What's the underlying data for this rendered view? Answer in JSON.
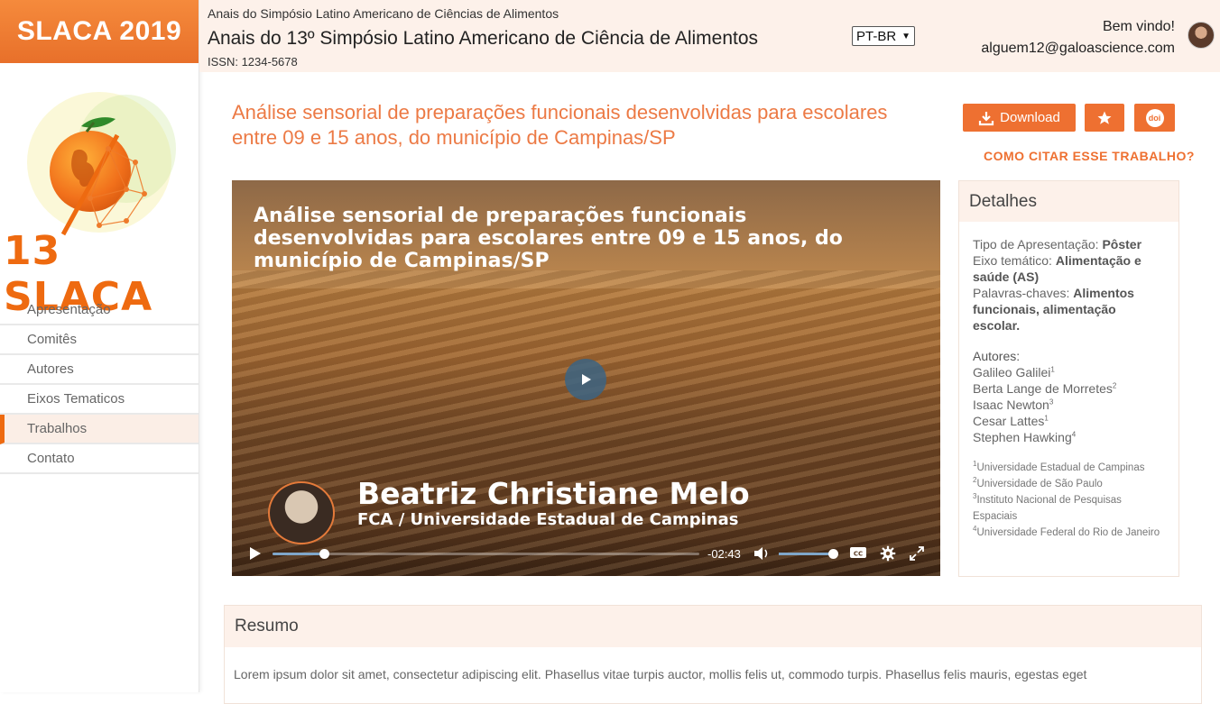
{
  "sidebar": {
    "brand": "SLACA 2019",
    "logo_text": "13 SLACA",
    "items": [
      {
        "label": "Apresentação"
      },
      {
        "label": "Comitês"
      },
      {
        "label": "Autores"
      },
      {
        "label": "Eixos Tematicos"
      },
      {
        "label": "Trabalhos",
        "active": true
      },
      {
        "label": "Contato"
      }
    ]
  },
  "header": {
    "small": "Anais do Simpósio Latino Americano de Ciências de Alimentos",
    "title": "Anais do 13º Simpósio Latino Americano de Ciência de Alimentos",
    "issn": "ISSN: 1234-5678",
    "language": "PT-BR",
    "welcome": "Bem vindo!",
    "email": "alguem12@galoascience.com"
  },
  "paper": {
    "title": "Análise sensorial de preparações funcionais desenvolvidas para escolares entre 09 e 15 anos, do município de Campinas/SP",
    "download_label": "Download",
    "doi_label": "doi",
    "cite_label": "COMO CITAR ESSE TRABALHO?"
  },
  "video": {
    "title": "Análise sensorial de preparações funcionais desenvolvidas para escolares entre 09 e 15 anos, do município de Campinas/SP",
    "presenter_name": "Beatriz Christiane Melo",
    "presenter_inst": "FCA / Universidade Estadual de Campinas",
    "time_remaining": "-02:43",
    "progress": 0.12,
    "volume": 1.0
  },
  "details": {
    "heading": "Detalhes",
    "tipo_label": "Tipo de Apresentação:",
    "tipo_value": "Pôster",
    "eixo_label": "Eixo temático:",
    "eixo_value": "Alimentação e saúde (AS)",
    "palavras_label": "Palavras-chaves:",
    "palavras_value": "Alimentos funcionais, alimentação escolar.",
    "autores_label": "Autores:",
    "authors": [
      {
        "name": "Galileo Galilei",
        "sup": "1"
      },
      {
        "name": "Berta Lange de Morretes",
        "sup": "2"
      },
      {
        "name": "Isaac Newton",
        "sup": "3"
      },
      {
        "name": "Cesar Lattes",
        "sup": "1"
      },
      {
        "name": "Stephen Hawking",
        "sup": "4"
      }
    ],
    "affiliations": [
      {
        "sup": "1",
        "name": "Universidade Estadual de Campinas"
      },
      {
        "sup": "2",
        "name": "Universidade de São Paulo"
      },
      {
        "sup": "3",
        "name": "Instituto Nacional de Pesquisas Espaciais"
      },
      {
        "sup": "4",
        "name": "Universidade Federal do Rio de Janeiro"
      }
    ]
  },
  "resumo": {
    "heading": "Resumo",
    "text": "Lorem ipsum dolor sit amet, consectetur adipiscing elit. Phasellus vitae turpis auctor, mollis felis ut, commodo turpis. Phasellus felis mauris, egestas eget"
  },
  "colors": {
    "accent": "#ee7031",
    "header_bg": "#fdf1ea"
  }
}
